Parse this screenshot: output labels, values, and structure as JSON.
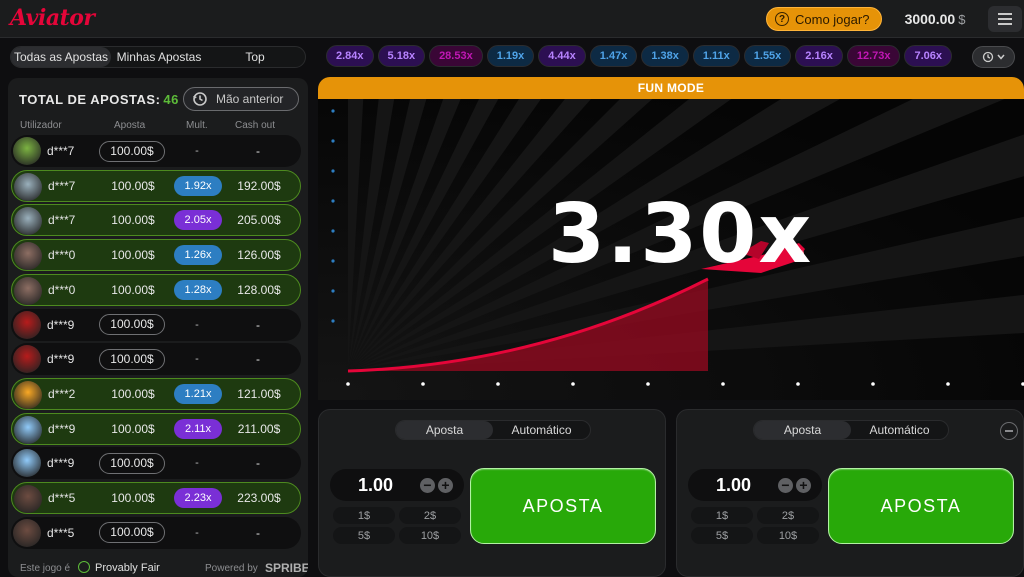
{
  "header": {
    "logo": "Aviator",
    "how_to_play": "Como jogar?",
    "balance": "3000.00",
    "currency": "$"
  },
  "tabs": [
    "Todas as Apostas",
    "Minhas Apostas",
    "Top"
  ],
  "bets": {
    "total_label": "TOTAL DE APOSTAS:",
    "total_count": "46",
    "prev_button": "Mão anterior",
    "columns": [
      "Utilizador",
      "Aposta",
      "Mult.",
      "Cash out"
    ],
    "rows": [
      {
        "user": "d***7",
        "stake": "100.00$",
        "mult": "-",
        "cashout": "-",
        "won": false,
        "avatar": "#7cb342"
      },
      {
        "user": "d***7",
        "stake": "100.00$",
        "mult": "1.92x",
        "cashout": "192.00$",
        "won": true,
        "avatar": "#9ab0bc"
      },
      {
        "user": "d***7",
        "stake": "100.00$",
        "mult": "2.05x",
        "cashout": "205.00$",
        "won": true,
        "avatar": "#9ab0bc"
      },
      {
        "user": "d***0",
        "stake": "100.00$",
        "mult": "1.26x",
        "cashout": "126.00$",
        "won": true,
        "avatar": "#8d6e63"
      },
      {
        "user": "d***0",
        "stake": "100.00$",
        "mult": "1.28x",
        "cashout": "128.00$",
        "won": true,
        "avatar": "#8d6e63"
      },
      {
        "user": "d***9",
        "stake": "100.00$",
        "mult": "-",
        "cashout": "-",
        "won": false,
        "avatar": "#b71c1c"
      },
      {
        "user": "d***9",
        "stake": "100.00$",
        "mult": "-",
        "cashout": "-",
        "won": false,
        "avatar": "#b71c1c"
      },
      {
        "user": "d***2",
        "stake": "100.00$",
        "mult": "1.21x",
        "cashout": "121.00$",
        "won": true,
        "avatar": "#f9a825"
      },
      {
        "user": "d***9",
        "stake": "100.00$",
        "mult": "2.11x",
        "cashout": "211.00$",
        "won": true,
        "avatar": "#90caf9"
      },
      {
        "user": "d***9",
        "stake": "100.00$",
        "mult": "-",
        "cashout": "-",
        "won": false,
        "avatar": "#90caf9"
      },
      {
        "user": "d***5",
        "stake": "100.00$",
        "mult": "2.23x",
        "cashout": "223.00$",
        "won": true,
        "avatar": "#6d4c41"
      },
      {
        "user": "d***5",
        "stake": "100.00$",
        "mult": "-",
        "cashout": "-",
        "won": false,
        "avatar": "#6d4c41"
      }
    ],
    "footer_left": "Este jogo é",
    "provably_fair": "Provably Fair",
    "powered_by": "Powered by",
    "powered_brand": "SPRIBE"
  },
  "history": [
    "2.84x",
    "5.18x",
    "28.53x",
    "1.19x",
    "4.44x",
    "1.47x",
    "1.38x",
    "1.11x",
    "1.55x",
    "2.16x",
    "12.73x",
    "7.06x"
  ],
  "colors": {
    "blue": "#2d7ec2",
    "purple": "#7a2fd6",
    "magenta": "#c017b4",
    "green": "#28a909",
    "orange": "#e69308",
    "red": "#e50539"
  },
  "game": {
    "mode_label": "FUN MODE",
    "multiplier": "3.30x"
  },
  "bet_panels": [
    {
      "tabs": [
        "Aposta",
        "Automático"
      ],
      "amount": "1.00",
      "quick": [
        "1$",
        "2$",
        "5$",
        "10$"
      ],
      "button": "APOSTA"
    },
    {
      "tabs": [
        "Aposta",
        "Automático"
      ],
      "amount": "1.00",
      "quick": [
        "1$",
        "2$",
        "5$",
        "10$"
      ],
      "button": "APOSTA"
    }
  ]
}
